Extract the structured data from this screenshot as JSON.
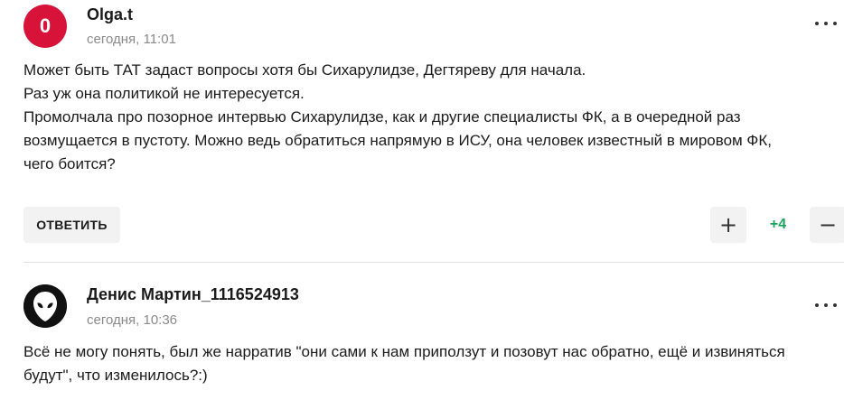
{
  "comments": [
    {
      "avatar_letter": "0",
      "username": "Olga.t",
      "time": "сегодня, 11:01",
      "lines": [
        "Может быть ТАТ задаст вопросы хотя бы Сихарулидзе, Дегтяреву для начала.",
        "Раз уж она политикой не интересуется.",
        "Промолчала про позорное интервью Сихарулидзе, как и другие специалисты ФК, а в очередной раз",
        "возмущается в пустоту. Можно ведь обратиться напрямую в ИСУ, она человек известный в мировом ФК,",
        "чего боится?"
      ],
      "reply_label": "ОТВЕТИТЬ",
      "upvote_symbol": "+",
      "rating": "+4",
      "downvote_symbol": "−"
    },
    {
      "avatar_icon": "alien-icon",
      "username": "Денис Мартин_1116524913",
      "time": "сегодня, 10:36",
      "lines": [
        "Всё не могу понять, был же нарратив \"они сами к нам приползут и позовут нас обратно, ещё и извиняться",
        "будут\", что изменилось?:)"
      ]
    }
  ],
  "colors": {
    "avatar_red": "#d7133a",
    "rating_green": "#1aa45a"
  }
}
